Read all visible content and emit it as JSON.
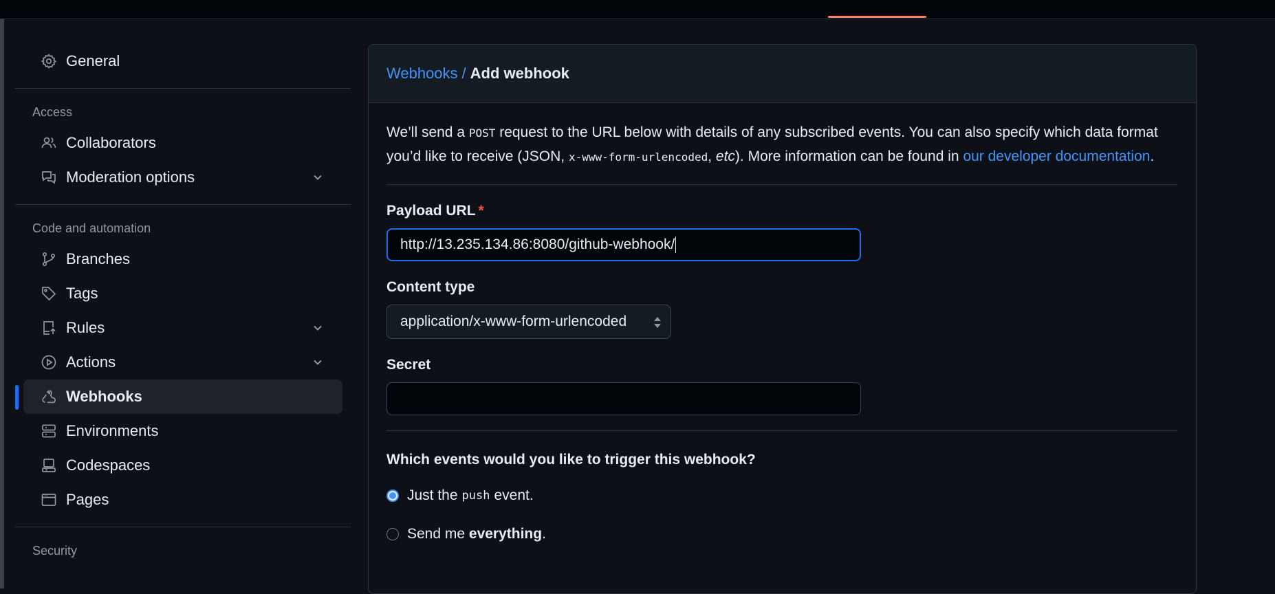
{
  "sidebar": {
    "general": "General",
    "access_label": "Access",
    "collaborators": "Collaborators",
    "moderation": "Moderation options",
    "code_label": "Code and automation",
    "branches": "Branches",
    "tags": "Tags",
    "rules": "Rules",
    "actions": "Actions",
    "webhooks": "Webhooks",
    "environments": "Environments",
    "codespaces": "Codespaces",
    "pages": "Pages",
    "security_label": "Security"
  },
  "breadcrumb": {
    "parent": "Webhooks",
    "separator": "/",
    "current": "Add webhook"
  },
  "intro": {
    "part1": "We’ll send a ",
    "post": "POST",
    "part2": " request to the URL below with details of any subscribed events. You can also specify which data format you’d like to receive (JSON, ",
    "urlencoded": "x-www-form-urlencoded",
    "comma": ", ",
    "etc": "etc",
    "part3": "). More information can be found in ",
    "link": "our developer documentation",
    "period": "."
  },
  "form": {
    "payload_label": "Payload URL",
    "required_mark": "*",
    "payload_value": "http://13.235.134.86:8080/github-webhook/",
    "content_type_label": "Content type",
    "content_type_value": "application/x-www-form-urlencoded",
    "secret_label": "Secret",
    "secret_value": ""
  },
  "events": {
    "question": "Which events would you like to trigger this webhook?",
    "opt1_pre": "Just the",
    "opt1_code": "push",
    "opt1_post": "event.",
    "opt2_pre": "Send me ",
    "opt2_bold": "everything",
    "opt2_post": "."
  },
  "colors": {
    "accent": "#1f6feb",
    "link": "#4493f8",
    "required": "#f85149",
    "tab_underline": "#f78166"
  }
}
